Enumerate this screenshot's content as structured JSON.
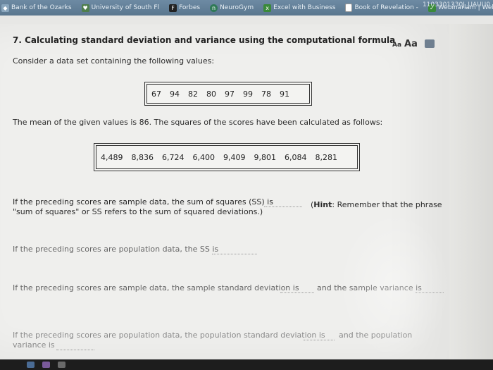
{
  "bookmarks": [
    {
      "label": "Bank of the Ozarks",
      "icon": "bank-icon",
      "color": "#8aa6bd"
    },
    {
      "label": "University of South Fl",
      "icon": "university-icon",
      "color": "#4f7f4c"
    },
    {
      "label": "Forbes",
      "icon": "forbes-icon",
      "color": "#222222"
    },
    {
      "label": "NeuroGym",
      "icon": "neurogym-icon",
      "color": "#2f7a57"
    },
    {
      "label": "Excel with Business",
      "icon": "excel-icon",
      "color": "#3a8a3a"
    },
    {
      "label": "Book of Revelation -",
      "icon": "page-icon",
      "color": "#ffffff"
    },
    {
      "label": "Webinarlam | Webin",
      "icon": "webinar-icon",
      "color": "#3a8a3a"
    }
  ],
  "bookmark_id": "1103301330J_UAUU0",
  "question": {
    "title": "7. Calculating standard deviation and variance using the computational formula",
    "intro": "Consider a data set containing the following values:",
    "values": [
      "67",
      "94",
      "82",
      "80",
      "97",
      "99",
      "78",
      "91"
    ],
    "mean_text": "The mean of the given values is 86. The squares of the scores have been calculated as follows:",
    "squares": [
      "4,489",
      "8,836",
      "6,724",
      "6,400",
      "9,409",
      "9,801",
      "6,084",
      "8,281"
    ],
    "q1_line1": "If the preceding scores are sample data, the sum of squares (SS) is",
    "q1_hint_bold": "Hint",
    "q1_hint_rest": ": Remember that the phrase",
    "q1_line2": "\"sum of squares\" or SS refers to the sum of squared deviations.)",
    "q2": "If the preceding scores are population data, the SS is",
    "q3_a": "If the preceding scores are sample data, the sample standard deviation is",
    "q3_b": "and the sample variance is",
    "q4_a": "If the preceding scores are population data, the population standard deviation is",
    "q4_b": "and the population",
    "q4_c": "variance is"
  },
  "tools": {
    "aa_small": "Aa",
    "aa_big": "Aa"
  }
}
